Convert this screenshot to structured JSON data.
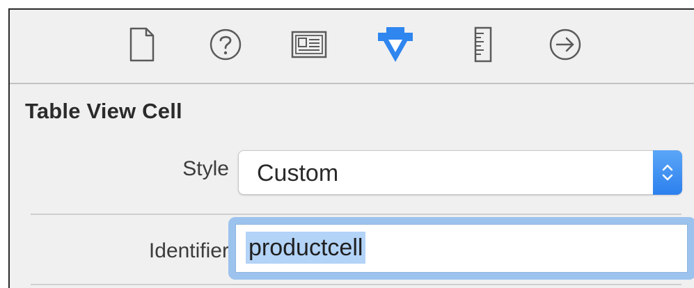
{
  "toolbar": {
    "icons": [
      {
        "name": "file-inspector-icon",
        "selected": false
      },
      {
        "name": "quick-help-icon",
        "selected": false
      },
      {
        "name": "identity-inspector-icon",
        "selected": false
      },
      {
        "name": "attributes-inspector-icon",
        "selected": true
      },
      {
        "name": "size-inspector-icon",
        "selected": false
      },
      {
        "name": "connections-inspector-icon",
        "selected": false
      }
    ]
  },
  "section": {
    "title": "Table View Cell"
  },
  "style_row": {
    "label": "Style",
    "value": "Custom"
  },
  "identifier_row": {
    "label": "Identifier",
    "value": "productcell"
  },
  "colors": {
    "accent": "#2f86ef",
    "focus_ring": "#9cc3ee",
    "selection": "#b3d3f7"
  }
}
